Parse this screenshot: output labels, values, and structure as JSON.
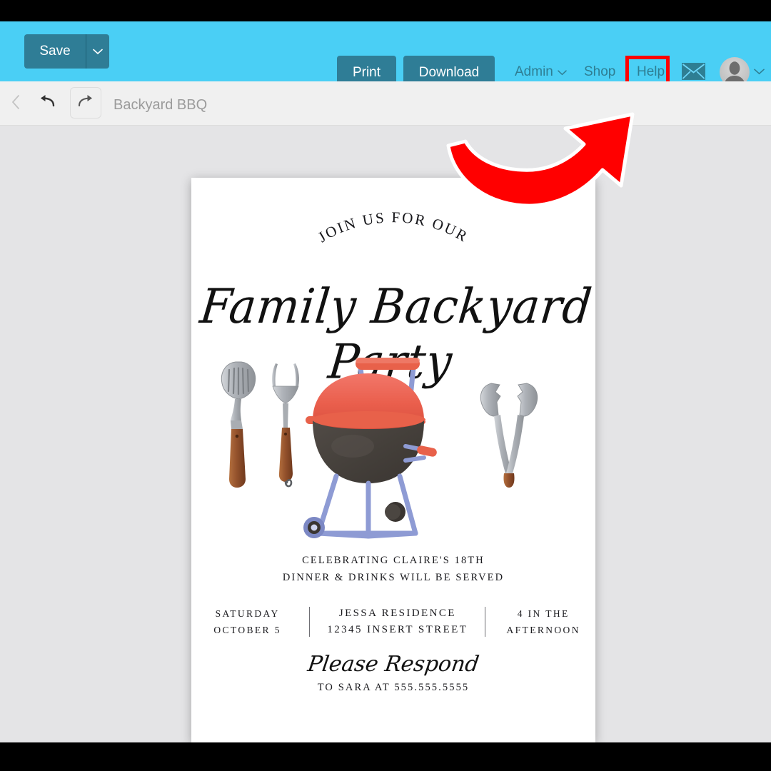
{
  "colors": {
    "topbar": "#4ACFF5",
    "button": "#2F7D96",
    "nav_text": "#2E7E93",
    "toolbar_bg": "#F0F0F0",
    "canvas_bg": "#E4E4E6",
    "highlight": "#FF0000",
    "card_bg": "#FFFFFF",
    "grill_lid": "#E8614A",
    "grill_bowl": "#494440",
    "grill_legs": "#8E9BD4",
    "tool_handle": "#9A5A34",
    "tool_metal": "#B9BCC1"
  },
  "topbar": {
    "save_label": "Save",
    "save_caret_icon": "chevron-down-icon",
    "print_label": "Print",
    "download_label": "Download",
    "nav": [
      {
        "label": "Admin",
        "icon": "chevron-down-icon"
      },
      {
        "label": "Shop",
        "icon": ""
      },
      {
        "label": "Help",
        "icon": ""
      }
    ],
    "mail_icon": "envelope-icon",
    "avatar_icon": "user-avatar-icon",
    "avatar_caret_icon": "chevron-down-icon"
  },
  "toolbar": {
    "back_icon": "chevron-left-icon",
    "undo_icon": "undo-arrow-icon",
    "redo_icon": "redo-arrow-icon",
    "document_title": "Backyard BBQ"
  },
  "annotation": {
    "highlight_target": "Help",
    "arrow_icon": "curved-red-arrow-icon"
  },
  "card": {
    "arch_text": "JOIN US FOR OUR",
    "script_title": "Family Backyard Party",
    "artwork": {
      "grill_icon": "bbq-kettle-grill-illustration",
      "utensils_icon": "spatula-and-fork-illustration",
      "tongs_icon": "bbq-tongs-illustration"
    },
    "detail_line_1": "CELEBRATING CLAIRE'S 18TH",
    "detail_line_2": "DINNER & DRINKS WILL BE SERVED",
    "info_columns": [
      {
        "line1": "SATURDAY",
        "line2": "OCTOBER 5"
      },
      {
        "line1": "JESSA RESIDENCE",
        "line2": "12345 INSERT STREET"
      },
      {
        "line1": "4 IN THE",
        "line2": "AFTERNOON"
      }
    ],
    "rsvp_script": "Please Respond",
    "rsvp_line": "TO SARA AT 555.555.5555"
  }
}
